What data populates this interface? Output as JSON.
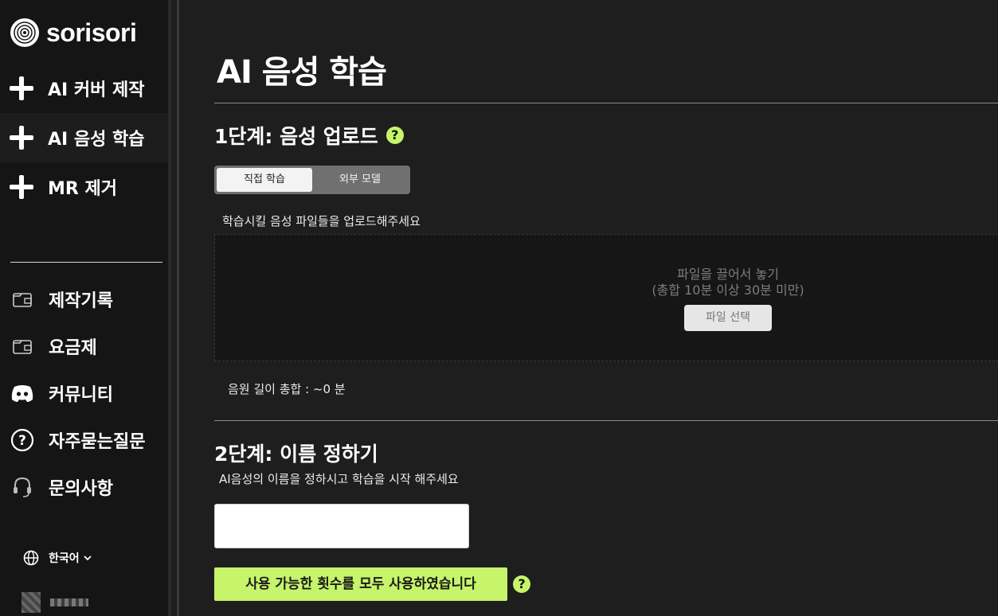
{
  "brand": {
    "name": "sorisori"
  },
  "sidebar": {
    "main_items": [
      {
        "label": "AI 커버 제작",
        "icon": "plus-icon"
      },
      {
        "label": "AI 음성 학습",
        "icon": "plus-icon",
        "active": true
      },
      {
        "label": "MR 제거",
        "icon": "plus-icon"
      }
    ],
    "sub_items": [
      {
        "label": "제작기록",
        "icon": "folder-icon"
      },
      {
        "label": "요금제",
        "icon": "folder-icon"
      },
      {
        "label": "커뮤니티",
        "icon": "discord-icon"
      },
      {
        "label": "자주묻는질문",
        "icon": "question-circle-icon"
      },
      {
        "label": "문의사항",
        "icon": "headset-icon"
      }
    ],
    "language": "한국어"
  },
  "main": {
    "title": "AI 음성 학습",
    "step1": {
      "title": "1단계: 음성 업로드",
      "tabs": [
        "직접 학습",
        "외부 모델"
      ],
      "active_tab": "직접 학습",
      "upload_desc": "학습시킬 음성 파일들을 업로드해주세요",
      "drop_line1": "파일을 끌어서 놓기",
      "drop_line2": "(총합 10분 이상 30분 미만)",
      "file_button": "파일 선택",
      "total_length": "음원 길이 총합 : ~0 분"
    },
    "step2": {
      "title": "2단계: 이름 정하기",
      "desc": "AI음성의 이름을 정하시고 학습을 시작 해주세요",
      "input_value": "",
      "submit_label": "사용 가능한 횟수를 모두 사용하였습니다"
    }
  },
  "colors": {
    "accent": "#c6f46a",
    "background": "#1e1e1e",
    "sidebar": "#151515"
  }
}
